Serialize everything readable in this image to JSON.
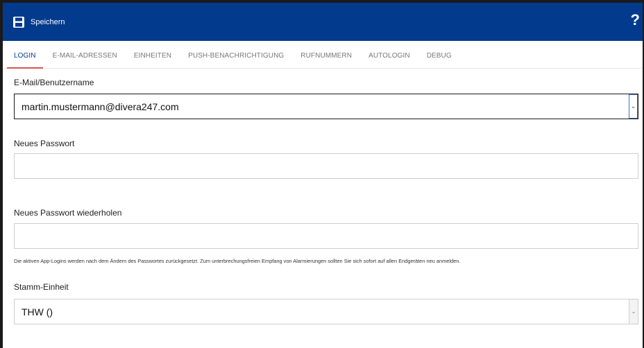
{
  "toolbar": {
    "save_label": "Speichern",
    "save_icon": "floppy-disk-icon",
    "help_label": "?"
  },
  "tabs": [
    {
      "label": "LOGIN",
      "active": true
    },
    {
      "label": "E-MAIL-ADRESSEN",
      "active": false
    },
    {
      "label": "EINHEITEN",
      "active": false
    },
    {
      "label": "PUSH-BENACHRICHTIGUNG",
      "active": false
    },
    {
      "label": "RUFNUMMERN",
      "active": false
    },
    {
      "label": "AUTOLOGIN",
      "active": false
    },
    {
      "label": "DEBUG",
      "active": false
    }
  ],
  "form": {
    "username_label": "E-Mail/Benutzername",
    "username_value": "martin.mustermann@divera247.com",
    "new_password_label": "Neues Passwort",
    "new_password_value": "",
    "repeat_password_label": "Neues Passwort wiederholen",
    "repeat_password_value": "",
    "hint": "Die aktiven App-Logins werden nach dem Ändern des Passwortes zurückgesetzt. Zum unterbrechungsfreien Empfang von Alarmierungen sollten Sie sich sofort auf allen Endgeräten neu anmelden.",
    "unit_label": "Stamm-Einheit",
    "unit_value": "THW ()"
  },
  "colors": {
    "header_bg": "#023a8e",
    "active_tab_text": "#023a8e",
    "active_tab_underline": "#d9534f"
  }
}
